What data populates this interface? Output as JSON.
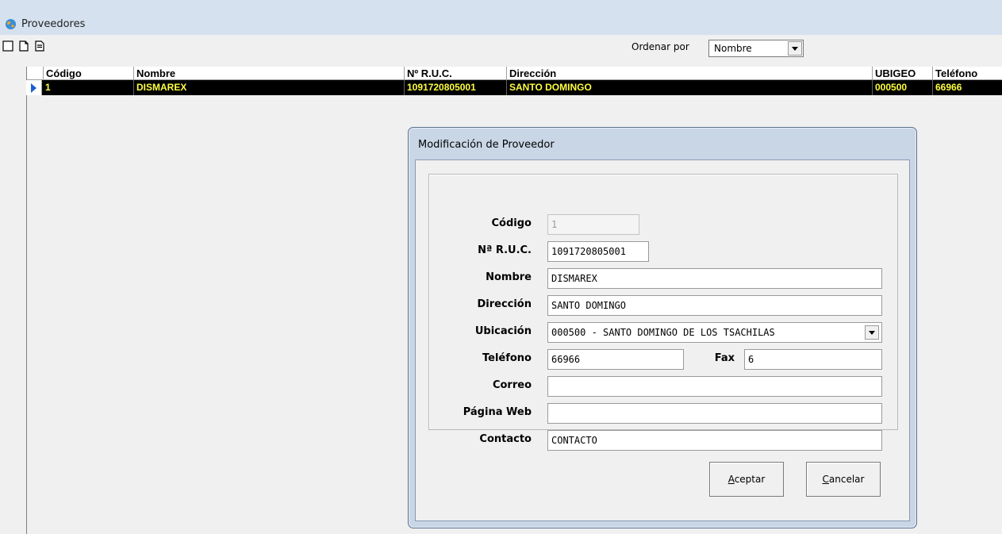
{
  "window": {
    "title": "Proveedores",
    "app_icon": "globe-icon"
  },
  "toolbar": {
    "icons": [
      "blank-square-icon",
      "new-document-icon",
      "printer-document-icon"
    ],
    "order_label": "Ordenar por",
    "order_value": "Nombre"
  },
  "grid": {
    "columns": [
      "Código",
      "Nombre",
      "Nº R.U.C.",
      "Dirección",
      "UBIGEO",
      "Teléfono"
    ],
    "rows": [
      [
        "1",
        "DISMAREX",
        "1091720805001",
        "SANTO DOMINGO",
        "000500",
        "66966"
      ]
    ]
  },
  "dialog": {
    "title": "Modificación de Proveedor",
    "labels": {
      "codigo": "Código",
      "ruc": "Nª R.U.C.",
      "nombre": "Nombre",
      "direccion": "Dirección",
      "ubicacion": "Ubicación",
      "telefono": "Teléfono",
      "fax": "Fax",
      "correo": "Correo",
      "pagina_web": "Página Web",
      "contacto": "Contacto"
    },
    "values": {
      "codigo": "1",
      "ruc": "1091720805001",
      "nombre": "DISMAREX",
      "direccion": "SANTO DOMINGO",
      "ubicacion": "000500 - SANTO DOMINGO DE LOS TSACHILAS",
      "telefono": "66966",
      "fax": "6",
      "correo": "",
      "pagina_web": "",
      "contacto": "CONTACTO"
    },
    "buttons": {
      "accept_first": "A",
      "accept_rest": "ceptar",
      "cancel_first": "C",
      "cancel_rest": "ancelar"
    }
  },
  "colors": {
    "selected_row_bg": "#000000",
    "selected_row_text": "#ffff40",
    "row_indicator": "#1a5fd1",
    "dialog_frame": "#c9d6e6"
  }
}
